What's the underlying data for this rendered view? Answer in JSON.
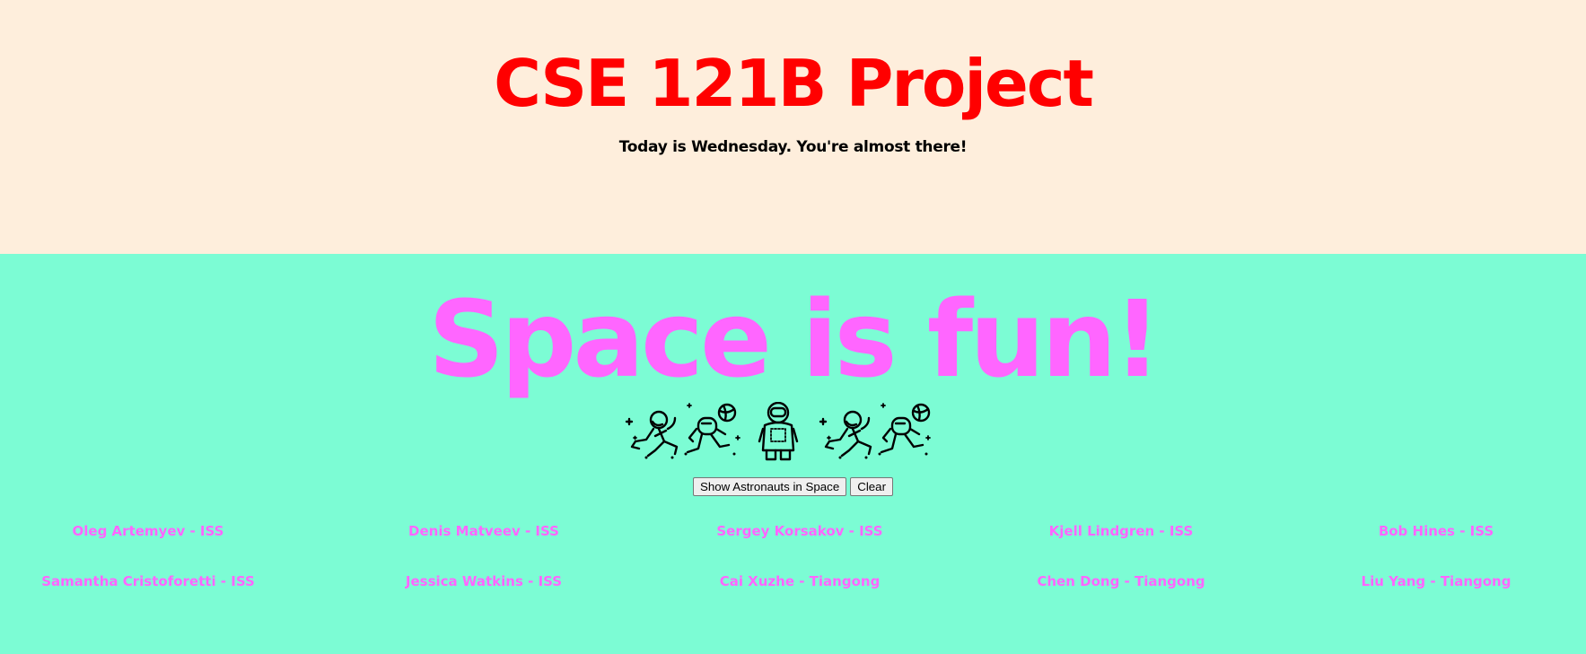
{
  "header": {
    "title": "CSE 121B Project",
    "subtitle": "Today is Wednesday. You're almost there!"
  },
  "main": {
    "hero_text": "Space is fun!",
    "icons": [
      "astronaut-floating-icon",
      "astronaut-with-planet-icon",
      "astronaut-standing-icon",
      "astronaut-floating-icon",
      "astronaut-with-planet-icon"
    ],
    "buttons": {
      "show_label": "Show Astronauts in Space",
      "clear_label": "Clear"
    },
    "astronauts": [
      "Oleg Artemyev - ISS",
      "Denis Matveev - ISS",
      "Sergey Korsakov - ISS",
      "Kjell Lindgren - ISS",
      "Bob Hines - ISS",
      "Samantha Cristoforetti - ISS",
      "Jessica Watkins - ISS",
      "Cai Xuzhe - Tiangong",
      "Chen Dong - Tiangong",
      "Liu Yang - Tiangong"
    ]
  },
  "colors": {
    "header_bg": "#FEEEDC",
    "main_bg": "#7CFCD4",
    "title": "#FF0000",
    "hero": "#FF66FF",
    "astronaut_text": "#FF66FF"
  }
}
